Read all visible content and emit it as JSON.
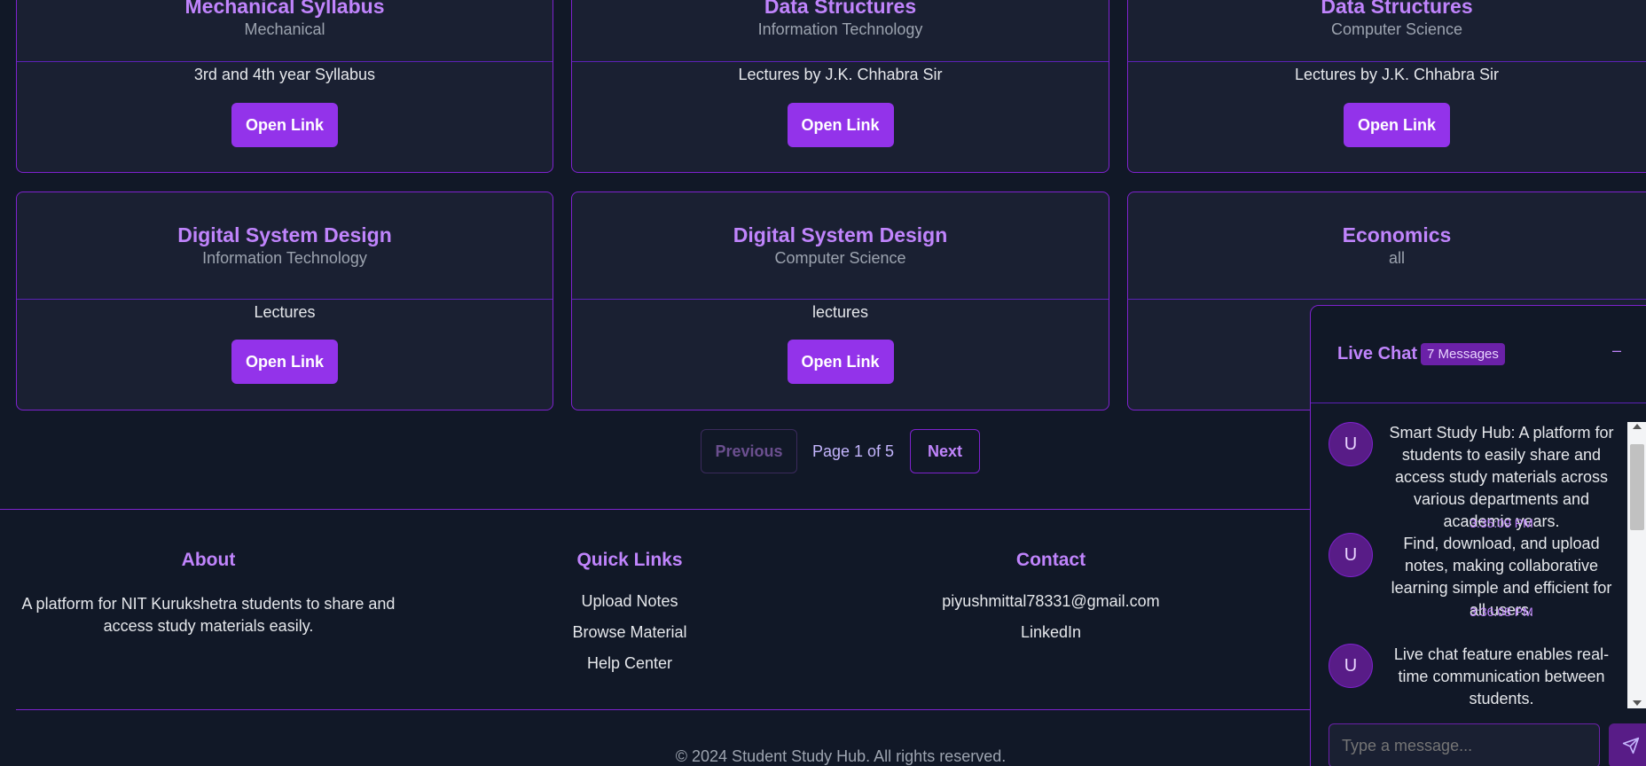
{
  "cards": [
    {
      "title": "Mechanical Syllabus",
      "subtitle": "Mechanical",
      "description": "3rd and 4th year Syllabus",
      "button": "Open Link"
    },
    {
      "title": "Data Structures",
      "subtitle": "Information Technology",
      "description": "Lectures by J.K. Chhabra Sir",
      "button": "Open Link"
    },
    {
      "title": "Data Structures",
      "subtitle": "Computer Science",
      "description": "Lectures by J.K. Chhabra Sir",
      "button": "Open Link"
    },
    {
      "title": "Digital System Design",
      "subtitle": "Information Technology",
      "description": "Lectures",
      "button": "Open Link"
    },
    {
      "title": "Digital System Design",
      "subtitle": "Computer Science",
      "description": "lectures",
      "button": "Open Link"
    },
    {
      "title": "Economics",
      "subtitle": "all"
    }
  ],
  "pagination": {
    "previous": "Previous",
    "status": "Page 1 of 5",
    "next": "Next"
  },
  "footer": {
    "about": {
      "heading": "About",
      "text": "A platform for NIT Kurukshetra students to share and access study materials easily."
    },
    "quick_links": {
      "heading": "Quick Links",
      "links": [
        "Upload Notes",
        "Browse Material",
        "Help Center"
      ]
    },
    "contact": {
      "heading": "Contact",
      "email": "piyushmittal78331@gmail.com",
      "linkedin": "LinkedIn"
    },
    "copyright": "© 2024 Student Study Hub. All rights reserved."
  },
  "chat": {
    "title": "Live Chat",
    "badge": "7 Messages",
    "minimize": "–",
    "messages": [
      {
        "avatar": "U",
        "text": "Smart Study Hub: A platform for students to easily share and access study materials across various departments and academic years.",
        "time": "3:35:09 PM"
      },
      {
        "avatar": "U",
        "text": "Find, download, and upload notes, making collaborative learning simple and efficient for all users.",
        "time": "3:36:08 PM"
      },
      {
        "avatar": "U",
        "text": "Live chat feature enables real-time communication between students.",
        "time": ""
      }
    ],
    "input_placeholder": "Type a message..."
  },
  "colors": {
    "accent": "#9333ea",
    "heading": "#c084fc",
    "background": "#111827",
    "card": "#1a2032"
  }
}
